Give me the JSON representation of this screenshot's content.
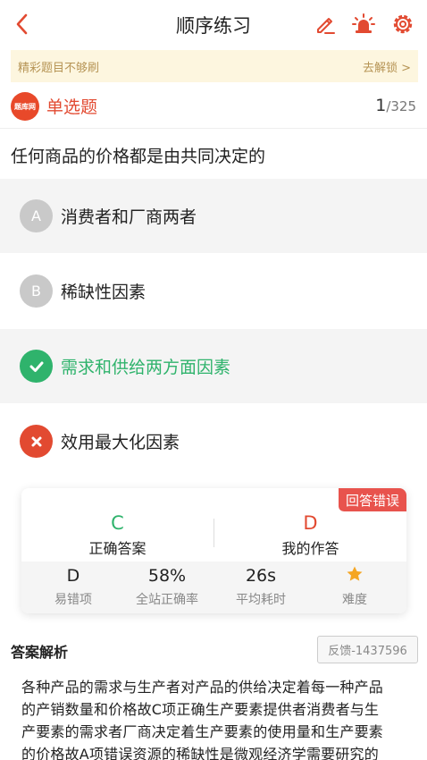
{
  "header": {
    "title": "顺序练习",
    "icons": [
      "back-arrow-icon",
      "edit-note-icon",
      "alarm-light-icon",
      "settings-gear-icon"
    ]
  },
  "promo": {
    "text": "精彩题目不够刷",
    "action": "去解锁 >"
  },
  "question_header": {
    "logo_text": "题库网",
    "type": "单选题",
    "current": "1",
    "total": "/325"
  },
  "question": {
    "text": "任何商品的价格都是由共同决定的"
  },
  "options": [
    {
      "letter": "A",
      "text": "消费者和厂商两者",
      "state": "normal"
    },
    {
      "letter": "B",
      "text": "稀缺性因素",
      "state": "normal"
    },
    {
      "letter": "C",
      "text": "需求和供给两方面因素",
      "state": "correct",
      "icon": "check-icon"
    },
    {
      "letter": "D",
      "text": "效用最大化因素",
      "state": "wrong",
      "icon": "cross-icon"
    }
  ],
  "result": {
    "tag": "回答错误",
    "correct_answer": "C",
    "correct_label": "正确答案",
    "my_answer": "D",
    "my_label": "我的作答",
    "stats": [
      {
        "value": "D",
        "label": "易错项"
      },
      {
        "value": "58%",
        "label": "全站正确率"
      },
      {
        "value": "26s",
        "label": "平均耗时"
      },
      {
        "value": "",
        "label": "难度",
        "icon": "star-icon",
        "stars": 1
      }
    ],
    "colors": {
      "correct": "#2fb36c",
      "wrong": "#e24a31"
    }
  },
  "explanation": {
    "heading": "答案解析",
    "feedback_label": "反馈-1437596",
    "lines": [
      "各种产品的需求与生产者对产品的供给决定着每一种产品",
      "的产销数量和价格故C项正确生产要素提供者消费者与生",
      "产要素的需求者厂商决定着生产要素的使用量和生产要素",
      "的价格故A项错误资源的稀缺性是微观经济学需要研究的"
    ]
  },
  "colors": {
    "accent_red": "#e24a31",
    "accent_green": "#2fb36c",
    "promo_bg": "#fdf6df",
    "promo_text": "#b69455"
  }
}
